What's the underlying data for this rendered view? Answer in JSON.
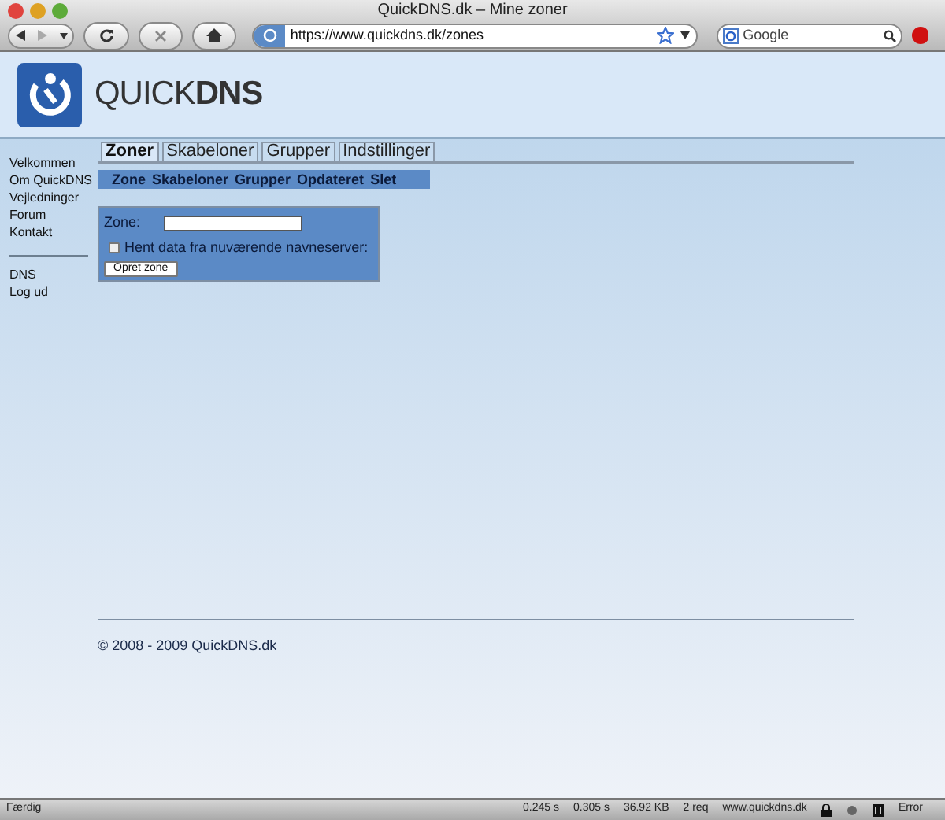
{
  "window": {
    "title": "QuickDNS.dk – Mine zoner"
  },
  "toolbar": {
    "url": "https://www.quickdns.dk/zones",
    "search": {
      "placeholder": "Google"
    }
  },
  "site": {
    "logo_light": "QUICK",
    "logo_bold": "DNS"
  },
  "sidebar": {
    "groups": [
      [
        "Velkommen",
        "Om QuickDNS",
        "Vejledninger",
        "Forum",
        "Kontakt"
      ],
      [
        "DNS",
        "Log ud"
      ]
    ]
  },
  "tabs": [
    {
      "label": "Zoner",
      "selected": true
    },
    {
      "label": "Skabeloner",
      "selected": false
    },
    {
      "label": "Grupper",
      "selected": false
    },
    {
      "label": "Indstillinger",
      "selected": false
    }
  ],
  "columns": [
    "Zone",
    "Skabeloner",
    "Grupper",
    "Opdateret",
    "Slet"
  ],
  "form": {
    "zone_label": "Zone:",
    "checkbox": {
      "label": "Hent data fra nuværende navneserver:",
      "checked": false
    },
    "submit": "Opret zone"
  },
  "footer": "© 2008 - 2009 QuickDNS.dk",
  "status_bar": {
    "status": "Færdig",
    "items": [
      "0.245 s",
      "0.305 s",
      "36.92 KB",
      "2 req",
      "www.quickdns.dk"
    ],
    "error": "Error"
  }
}
